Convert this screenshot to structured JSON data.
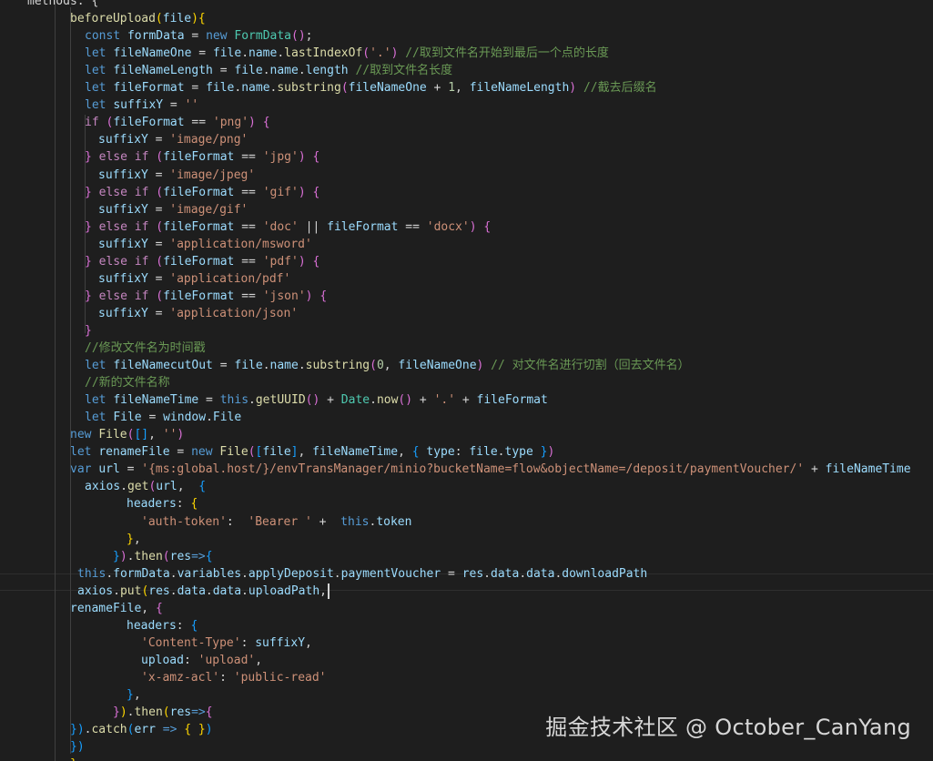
{
  "editor": {
    "lines": [
      [
        [
          "methods: {",
          "pun"
        ]
      ],
      [
        [
          "beforeUpload",
          "fn"
        ],
        [
          "(",
          "b1"
        ],
        [
          "file",
          "var"
        ],
        [
          ")",
          "b1"
        ],
        [
          "{",
          "b1"
        ]
      ],
      [
        [
          "const ",
          "kw"
        ],
        [
          "formData",
          "var"
        ],
        [
          " = ",
          "pun"
        ],
        [
          "new ",
          "kw"
        ],
        [
          "FormData",
          "cls"
        ],
        [
          "()",
          "b2"
        ],
        [
          ";",
          "pun"
        ]
      ],
      [
        [
          "let ",
          "kw"
        ],
        [
          "fileNameOne",
          "var"
        ],
        [
          " = ",
          "pun"
        ],
        [
          "file",
          "var"
        ],
        [
          ".",
          "pun"
        ],
        [
          "name",
          "var"
        ],
        [
          ".",
          "pun"
        ],
        [
          "lastIndexOf",
          "fn"
        ],
        [
          "(",
          "b2"
        ],
        [
          "'.'",
          "str"
        ],
        [
          ")",
          "b2"
        ],
        [
          " ",
          "pun"
        ],
        [
          "//取到文件名开始到最后一个点的长度",
          "cmt"
        ]
      ],
      [
        [
          "let ",
          "kw"
        ],
        [
          "fileNameLength",
          "var"
        ],
        [
          " = ",
          "pun"
        ],
        [
          "file",
          "var"
        ],
        [
          ".",
          "pun"
        ],
        [
          "name",
          "var"
        ],
        [
          ".",
          "pun"
        ],
        [
          "length",
          "var"
        ],
        [
          " ",
          "pun"
        ],
        [
          "//取到文件名长度",
          "cmt"
        ]
      ],
      [
        [
          "let ",
          "kw"
        ],
        [
          "fileFormat",
          "var"
        ],
        [
          " = ",
          "pun"
        ],
        [
          "file",
          "var"
        ],
        [
          ".",
          "pun"
        ],
        [
          "name",
          "var"
        ],
        [
          ".",
          "pun"
        ],
        [
          "substring",
          "fn"
        ],
        [
          "(",
          "b2"
        ],
        [
          "fileNameOne",
          "var"
        ],
        [
          " + ",
          "pun"
        ],
        [
          "1",
          "num"
        ],
        [
          ", ",
          "pun"
        ],
        [
          "fileNameLength",
          "var"
        ],
        [
          ")",
          "b2"
        ],
        [
          " ",
          "pun"
        ],
        [
          "//截去后缀名",
          "cmt"
        ]
      ],
      [
        [
          "let ",
          "kw"
        ],
        [
          "suffixY",
          "var"
        ],
        [
          " = ",
          "pun"
        ],
        [
          "''",
          "str"
        ]
      ],
      [
        [
          "if ",
          "ctl"
        ],
        [
          "(",
          "b2"
        ],
        [
          "fileFormat",
          "var"
        ],
        [
          " == ",
          "pun"
        ],
        [
          "'png'",
          "str"
        ],
        [
          ")",
          "b2"
        ],
        [
          " ",
          "pun"
        ],
        [
          "{",
          "b2"
        ]
      ],
      [
        [
          "suffixY",
          "var"
        ],
        [
          " = ",
          "pun"
        ],
        [
          "'image/png'",
          "str"
        ]
      ],
      [
        [
          "}",
          "b2"
        ],
        [
          " else if ",
          "ctl"
        ],
        [
          "(",
          "b2"
        ],
        [
          "fileFormat",
          "var"
        ],
        [
          " == ",
          "pun"
        ],
        [
          "'jpg'",
          "str"
        ],
        [
          ")",
          "b2"
        ],
        [
          " ",
          "pun"
        ],
        [
          "{",
          "b2"
        ]
      ],
      [
        [
          "suffixY",
          "var"
        ],
        [
          " = ",
          "pun"
        ],
        [
          "'image/jpeg'",
          "str"
        ]
      ],
      [
        [
          "}",
          "b2"
        ],
        [
          " else if ",
          "ctl"
        ],
        [
          "(",
          "b2"
        ],
        [
          "fileFormat",
          "var"
        ],
        [
          " == ",
          "pun"
        ],
        [
          "'gif'",
          "str"
        ],
        [
          ")",
          "b2"
        ],
        [
          " ",
          "pun"
        ],
        [
          "{",
          "b2"
        ]
      ],
      [
        [
          "suffixY",
          "var"
        ],
        [
          " = ",
          "pun"
        ],
        [
          "'image/gif'",
          "str"
        ]
      ],
      [
        [
          "}",
          "b2"
        ],
        [
          " else if ",
          "ctl"
        ],
        [
          "(",
          "b2"
        ],
        [
          "fileFormat",
          "var"
        ],
        [
          " == ",
          "pun"
        ],
        [
          "'doc'",
          "str"
        ],
        [
          " || ",
          "pun"
        ],
        [
          "fileFormat",
          "var"
        ],
        [
          " == ",
          "pun"
        ],
        [
          "'docx'",
          "str"
        ],
        [
          ")",
          "b2"
        ],
        [
          " ",
          "pun"
        ],
        [
          "{",
          "b2"
        ]
      ],
      [
        [
          "suffixY",
          "var"
        ],
        [
          " = ",
          "pun"
        ],
        [
          "'application/msword'",
          "str"
        ]
      ],
      [
        [
          "}",
          "b2"
        ],
        [
          " else if ",
          "ctl"
        ],
        [
          "(",
          "b2"
        ],
        [
          "fileFormat",
          "var"
        ],
        [
          " == ",
          "pun"
        ],
        [
          "'pdf'",
          "str"
        ],
        [
          ")",
          "b2"
        ],
        [
          " ",
          "pun"
        ],
        [
          "{",
          "b2"
        ]
      ],
      [
        [
          "suffixY",
          "var"
        ],
        [
          " = ",
          "pun"
        ],
        [
          "'application/pdf'",
          "str"
        ]
      ],
      [
        [
          "}",
          "b2"
        ],
        [
          " else if ",
          "ctl"
        ],
        [
          "(",
          "b2"
        ],
        [
          "fileFormat",
          "var"
        ],
        [
          " == ",
          "pun"
        ],
        [
          "'json'",
          "str"
        ],
        [
          ")",
          "b2"
        ],
        [
          " ",
          "pun"
        ],
        [
          "{",
          "b2"
        ]
      ],
      [
        [
          "suffixY",
          "var"
        ],
        [
          " = ",
          "pun"
        ],
        [
          "'application/json'",
          "str"
        ]
      ],
      [
        [
          "}",
          "b2"
        ]
      ],
      [
        [
          "//修改文件名为时间戳",
          "cmt"
        ]
      ],
      [
        [
          "let ",
          "kw"
        ],
        [
          "fileNamecutOut",
          "var"
        ],
        [
          " = ",
          "pun"
        ],
        [
          "file",
          "var"
        ],
        [
          ".",
          "pun"
        ],
        [
          "name",
          "var"
        ],
        [
          ".",
          "pun"
        ],
        [
          "substring",
          "fn"
        ],
        [
          "(",
          "b2"
        ],
        [
          "0",
          "num"
        ],
        [
          ", ",
          "pun"
        ],
        [
          "fileNameOne",
          "var"
        ],
        [
          ")",
          "b2"
        ],
        [
          " ",
          "pun"
        ],
        [
          "// 对文件名进行切割（回去文件名）",
          "cmt"
        ]
      ],
      [
        [
          "//新的文件名称",
          "cmt"
        ]
      ],
      [
        [
          "let ",
          "kw"
        ],
        [
          "fileNameTime",
          "var"
        ],
        [
          " = ",
          "pun"
        ],
        [
          "this",
          "kw"
        ],
        [
          ".",
          "pun"
        ],
        [
          "getUUID",
          "fn"
        ],
        [
          "()",
          "b2"
        ],
        [
          " + ",
          "pun"
        ],
        [
          "Date",
          "cls"
        ],
        [
          ".",
          "pun"
        ],
        [
          "now",
          "fn"
        ],
        [
          "()",
          "b2"
        ],
        [
          " + ",
          "pun"
        ],
        [
          "'.'",
          "str"
        ],
        [
          " + ",
          "pun"
        ],
        [
          "fileFormat",
          "var"
        ]
      ],
      [
        [
          "let ",
          "kw"
        ],
        [
          "File",
          "var"
        ],
        [
          " = ",
          "pun"
        ],
        [
          "window",
          "var"
        ],
        [
          ".",
          "pun"
        ],
        [
          "File",
          "var"
        ]
      ],
      [
        [
          "new ",
          "kw"
        ],
        [
          "File",
          "fn"
        ],
        [
          "(",
          "b2"
        ],
        [
          "[]",
          "b3"
        ],
        [
          ", ",
          "pun"
        ],
        [
          "''",
          "str"
        ],
        [
          ")",
          "b2"
        ]
      ],
      [
        [
          "let ",
          "kw"
        ],
        [
          "renameFile",
          "var"
        ],
        [
          " = ",
          "pun"
        ],
        [
          "new ",
          "kw"
        ],
        [
          "File",
          "fn"
        ],
        [
          "(",
          "b2"
        ],
        [
          "[",
          "b3"
        ],
        [
          "file",
          "var"
        ],
        [
          "]",
          "b3"
        ],
        [
          ", ",
          "pun"
        ],
        [
          "fileNameTime",
          "var"
        ],
        [
          ", ",
          "pun"
        ],
        [
          "{",
          "b3"
        ],
        [
          " type",
          "var"
        ],
        [
          ": ",
          "pun"
        ],
        [
          "file",
          "var"
        ],
        [
          ".",
          "pun"
        ],
        [
          "type",
          "var"
        ],
        [
          " ",
          "pun"
        ],
        [
          "}",
          "b3"
        ],
        [
          ")",
          "b2"
        ]
      ],
      [
        [
          "var ",
          "kw"
        ],
        [
          "url",
          "var"
        ],
        [
          " = ",
          "pun"
        ],
        [
          "'{ms:global.host/}/envTransManager/minio?bucketName=flow&objectName=/deposit/paymentVoucher/'",
          "str"
        ],
        [
          " + ",
          "pun"
        ],
        [
          "fileNameTime",
          "var"
        ]
      ],
      [
        [
          "axios",
          "var"
        ],
        [
          ".",
          "pun"
        ],
        [
          "get",
          "fn"
        ],
        [
          "(",
          "b2"
        ],
        [
          "url",
          "var"
        ],
        [
          ",  ",
          "pun"
        ],
        [
          "{",
          "b3"
        ]
      ],
      [
        [
          "headers",
          "var"
        ],
        [
          ": ",
          "pun"
        ],
        [
          "{",
          "b1"
        ]
      ],
      [
        [
          "'auth-token'",
          "str"
        ],
        [
          ":  ",
          "pun"
        ],
        [
          "'Bearer '",
          "str"
        ],
        [
          " +  ",
          "pun"
        ],
        [
          "this",
          "kw"
        ],
        [
          ".",
          "pun"
        ],
        [
          "token",
          "var"
        ]
      ],
      [
        [
          "}",
          "b1"
        ],
        [
          ",",
          "pun"
        ]
      ],
      [
        [
          "}",
          "b3"
        ],
        [
          ")",
          "b2"
        ],
        [
          ".",
          "pun"
        ],
        [
          "then",
          "fn"
        ],
        [
          "(",
          "b2"
        ],
        [
          "res",
          "var"
        ],
        [
          "=>",
          "kw"
        ],
        [
          "{",
          "b3"
        ]
      ],
      [
        [
          "this",
          "kw"
        ],
        [
          ".",
          "pun"
        ],
        [
          "formData",
          "var"
        ],
        [
          ".",
          "pun"
        ],
        [
          "variables",
          "var"
        ],
        [
          ".",
          "pun"
        ],
        [
          "applyDeposit",
          "var"
        ],
        [
          ".",
          "pun"
        ],
        [
          "paymentVoucher",
          "var"
        ],
        [
          " = ",
          "pun"
        ],
        [
          "res",
          "var"
        ],
        [
          ".",
          "pun"
        ],
        [
          "data",
          "var"
        ],
        [
          ".",
          "pun"
        ],
        [
          "data",
          "var"
        ],
        [
          ".",
          "pun"
        ],
        [
          "downloadPath",
          "var"
        ]
      ],
      [
        [
          "axios",
          "var"
        ],
        [
          ".",
          "pun"
        ],
        [
          "put",
          "fn"
        ],
        [
          "(",
          "b1"
        ],
        [
          "res",
          "var"
        ],
        [
          ".",
          "pun"
        ],
        [
          "data",
          "var"
        ],
        [
          ".",
          "pun"
        ],
        [
          "data",
          "var"
        ],
        [
          ".",
          "pun"
        ],
        [
          "uploadPath",
          "var"
        ],
        [
          ", ",
          "pun"
        ]
      ],
      [
        [
          "renameFile",
          "var"
        ],
        [
          ", ",
          "pun"
        ],
        [
          "{",
          "b2"
        ]
      ],
      [
        [
          "headers",
          "var"
        ],
        [
          ": ",
          "pun"
        ],
        [
          "{",
          "b3"
        ]
      ],
      [
        [
          "'Content-Type'",
          "str"
        ],
        [
          ": ",
          "pun"
        ],
        [
          "suffixY",
          "var"
        ],
        [
          ",",
          "pun"
        ]
      ],
      [
        [
          "upload",
          "var"
        ],
        [
          ": ",
          "pun"
        ],
        [
          "'upload'",
          "str"
        ],
        [
          ",",
          "pun"
        ]
      ],
      [
        [
          "'x-amz-acl'",
          "str"
        ],
        [
          ": ",
          "pun"
        ],
        [
          "'public-read'",
          "str"
        ]
      ],
      [
        [
          "}",
          "b3"
        ],
        [
          ",",
          "pun"
        ]
      ],
      [
        [
          "}",
          "b2"
        ],
        [
          ")",
          "b1"
        ],
        [
          ".",
          "pun"
        ],
        [
          "then",
          "fn"
        ],
        [
          "(",
          "b1"
        ],
        [
          "res",
          "var"
        ],
        [
          "=>",
          "kw"
        ],
        [
          "{",
          "b2"
        ]
      ],
      [
        [
          "}",
          "b3"
        ],
        [
          ")",
          "b3"
        ],
        [
          ".",
          "pun"
        ],
        [
          "catch",
          "fn"
        ],
        [
          "(",
          "b3"
        ],
        [
          "err",
          "var"
        ],
        [
          " => ",
          "kw"
        ],
        [
          "{ }",
          "b1"
        ],
        [
          ")",
          "b3"
        ]
      ],
      [
        [
          "}",
          "b3"
        ],
        [
          ")",
          "b3"
        ]
      ],
      [
        [
          "}",
          "b1"
        ]
      ]
    ]
  },
  "watermark": "掘金技术社区 @ October_CanYang"
}
